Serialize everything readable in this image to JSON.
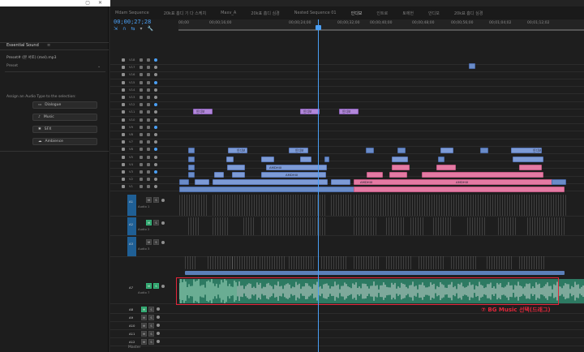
{
  "window": {
    "controls": [
      "▢",
      "✕"
    ]
  },
  "essential_sound": {
    "panel_title": "Essential Sound",
    "clip_name": "Preset# (본 서토) (mel).mp3",
    "preset_label": "Preset",
    "assign_text": "Assign an Audio Type to the selection:",
    "types": [
      {
        "label": "Dialogue",
        "icon": "dialogue-icon"
      },
      {
        "label": "Music",
        "icon": "music-icon"
      },
      {
        "label": "SFX",
        "icon": "sfx-icon"
      },
      {
        "label": "Ambience",
        "icon": "ambience-icon"
      }
    ]
  },
  "timeline": {
    "timecode": "00;00;27;28",
    "tabs": [
      "Mdam Sequence",
      "20k표 흠디 기 다 스케치",
      "Maxv_A",
      "20k표 흠디 심경",
      "Nested Sequence 01",
      "인디보",
      "인트로",
      "토에헌",
      "안디보",
      "20k표 흠디 심경"
    ],
    "active_tab_index": 5,
    "ruler_labels": [
      "00;00",
      "00;00;16;00",
      "00;00;24;00",
      "00;00;32;00",
      "00;00;40;00",
      "00;00;48;00",
      "00;00;56;00",
      "00;01;04;02",
      "00;01;12;02"
    ],
    "video_tracks": [
      "V18",
      "V17",
      "V16",
      "V15",
      "V14",
      "V13",
      "V12",
      "V11",
      "V10",
      "V9",
      "V8",
      "V7",
      "V6",
      "V5",
      "V4",
      "V3",
      "V2",
      "V1"
    ],
    "audio_tracks": [
      {
        "id": "A1",
        "name": "Audio 1"
      },
      {
        "id": "A2",
        "name": "Audio 2"
      },
      {
        "id": "A3",
        "name": "Audio 3"
      },
      {
        "id": "A7",
        "name": "Audio 7"
      },
      {
        "id": "A8",
        "name": ""
      },
      {
        "id": "A9",
        "name": ""
      },
      {
        "id": "A10",
        "name": ""
      },
      {
        "id": "A11",
        "name": ""
      },
      {
        "id": "A12",
        "name": ""
      }
    ],
    "master_label": "Master",
    "clip_labels": {
      "interview": "인디보",
      "title": "인디보 Lngo",
      "video": "AMDHIX"
    }
  },
  "annotation": {
    "text": "⑦ BG Music 선택(드래그)",
    "color": "#e2263a"
  }
}
